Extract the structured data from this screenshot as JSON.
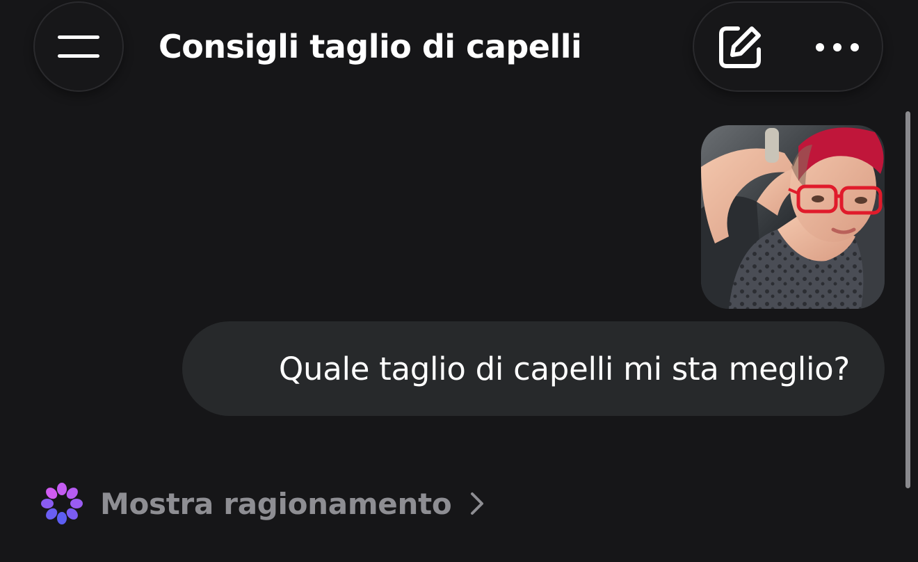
{
  "header": {
    "menu_icon": "hamburger-menu-icon",
    "title": "Consigli taglio di capelli",
    "actions": {
      "new_chat_icon": "compose-edit-icon",
      "more_icon": "more-horizontal-icon"
    }
  },
  "conversation": {
    "user_message": {
      "attachment_icon": "photo-thumbnail",
      "text": "Quale taglio di capelli mi sta meglio?"
    },
    "assistant": {
      "reasoning_icon": "sparkle-flower-icon",
      "reasoning_label": "Mostra ragionamento",
      "chevron_icon": "chevron-right-icon"
    }
  },
  "colors": {
    "background": "#161618",
    "bubble": "#27292b",
    "muted_text": "#8e8e93",
    "accent_purple": "#a85bf5",
    "accent_blue": "#5b6cf5"
  }
}
